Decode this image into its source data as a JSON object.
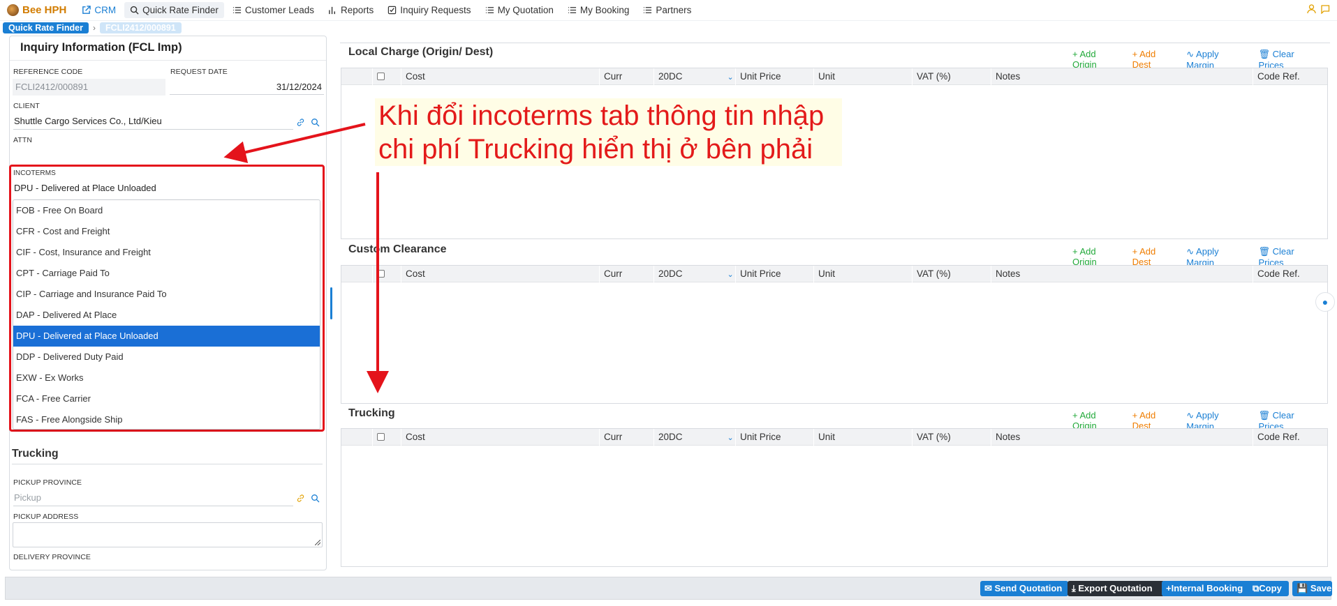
{
  "nav": {
    "brand": "Bee HPH",
    "items": [
      {
        "label": "CRM",
        "icon": "external-link-icon"
      },
      {
        "label": "Quick Rate Finder",
        "icon": "search-icon"
      },
      {
        "label": "Customer Leads",
        "icon": "list-icon"
      },
      {
        "label": "Reports",
        "icon": "bar-chart-icon"
      },
      {
        "label": "Inquiry Requests",
        "icon": "checkbox-icon"
      },
      {
        "label": "My Quotation",
        "icon": "list-icon"
      },
      {
        "label": "My Booking",
        "icon": "list-icon"
      },
      {
        "label": "Partners",
        "icon": "list-icon"
      }
    ]
  },
  "breadcrumb": {
    "root": "Quick Rate Finder",
    "current": "FCLI2412/000891"
  },
  "inquiry": {
    "title": "Inquiry Information (FCL Imp)",
    "reference_code_label": "REFERENCE CODE",
    "reference_code": "FCLI2412/000891",
    "request_date_label": "REQUEST DATE",
    "request_date": "31/12/2024",
    "client_label": "CLIENT",
    "client": "Shuttle Cargo Services Co., Ltd/Kieu",
    "attn_label": "ATTN",
    "incoterms_label": "INCOTERMS",
    "incoterms_value": "DPU - Delivered at Place Unloaded",
    "incoterm_options": [
      "FOB - Free On Board",
      "CFR - Cost and Freight",
      "CIF - Cost, Insurance and Freight",
      "CPT - Carriage Paid To",
      "CIP - Carriage and Insurance Paid To",
      "DAP - Delivered At Place",
      "DPU - Delivered at Place Unloaded",
      "DDP - Delivered Duty Paid",
      "EXW - Ex Works",
      "FCA - Free Carrier",
      "FAS - Free Alongside Ship"
    ],
    "selected_option": "DPU - Delivered at Place Unloaded",
    "trucking_title": "Trucking",
    "pickup_province_label": "PICKUP PROVINCE",
    "pickup_province_placeholder": "Pickup",
    "pickup_address_label": "PICKUP ADDRESS",
    "delivery_province_label": "DELIVERY PROVINCE"
  },
  "sections": [
    {
      "title": "Local Charge (Origin/ Dest)"
    },
    {
      "title": "Custom Clearance"
    },
    {
      "title": "Trucking"
    }
  ],
  "section_actions": {
    "add_origin": "+ Add Origin",
    "add_dest": "+ Add Dest",
    "apply_margin": "Apply Margin",
    "clear_prices": "Clear Prices"
  },
  "table_headers": {
    "index": "#",
    "cost": "Cost",
    "curr": "Curr",
    "container": "20DC",
    "unit_price": "Unit Price",
    "unit": "Unit",
    "vat": "VAT (%)",
    "notes": "Notes",
    "code_ref": "Code Ref."
  },
  "annotation": {
    "text_line1": "Khi đổi incoterms tab thông tin nhập",
    "text_line2": "chi phí Trucking hiển thị ở bên phải",
    "color": "#e31a1a"
  },
  "footer": {
    "send_quotation": "Send Quotation",
    "export_quotation": "Export Quotation",
    "internal_booking": "+Internal Booking",
    "copy": "Copy",
    "save": "Save"
  },
  "colors": {
    "primary": "#1a7fd4",
    "brand": "#d27c00",
    "add_origin": "#22a93a",
    "add_dest": "#ef7d00",
    "highlight": "#e4131b"
  }
}
